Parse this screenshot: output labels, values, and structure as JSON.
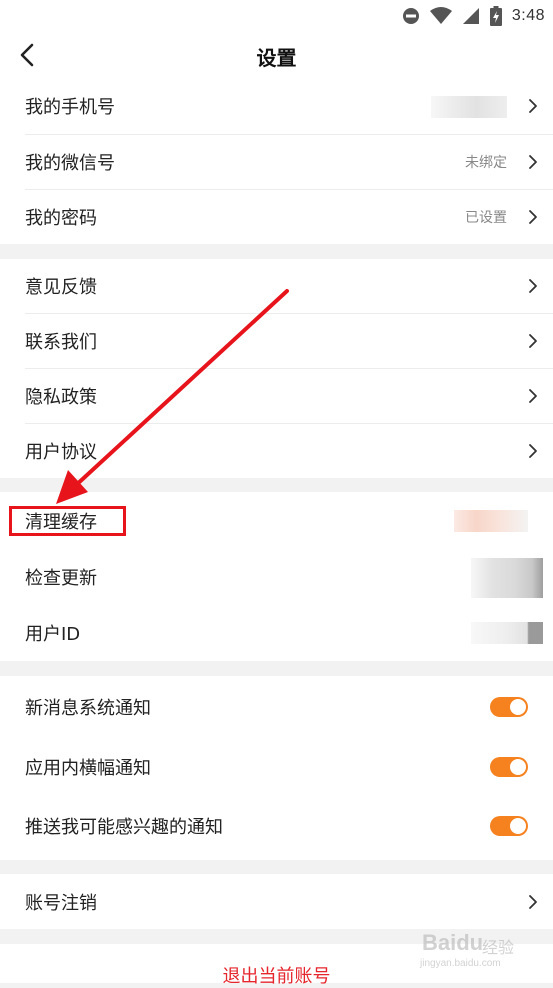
{
  "status_bar": {
    "time": "3:48",
    "icons": [
      "do-not-disturb-icon",
      "wifi-icon",
      "signal-icon",
      "battery-charging-icon"
    ]
  },
  "nav": {
    "title": "设置",
    "back_icon": "chevron-left-icon"
  },
  "account_group": [
    {
      "label": "我的手机号",
      "value": ""
    },
    {
      "label": "我的微信号",
      "value": "未绑定"
    },
    {
      "label": "我的密码",
      "value": "已设置"
    }
  ],
  "info_group": [
    {
      "label": "意见反馈"
    },
    {
      "label": "联系我们"
    },
    {
      "label": "隐私政策"
    },
    {
      "label": "用户协议"
    }
  ],
  "app_group": [
    {
      "label": "清理缓存"
    },
    {
      "label": "检查更新"
    },
    {
      "label": "用户ID"
    }
  ],
  "notify_group": [
    {
      "label": "新消息系统通知",
      "enabled": true
    },
    {
      "label": "应用内横幅通知",
      "enabled": true
    },
    {
      "label": "推送我可能感兴趣的通知",
      "enabled": true
    }
  ],
  "cancel_group": [
    {
      "label": "账号注销"
    }
  ],
  "logout_label": "退出当前账号",
  "colors": {
    "accent": "#f5821f",
    "danger": "#e5262c",
    "annotation": "#e8141c"
  },
  "watermark": {
    "logo": "Baidu",
    "sub": "经验",
    "url": "jingyan.baidu.com"
  }
}
